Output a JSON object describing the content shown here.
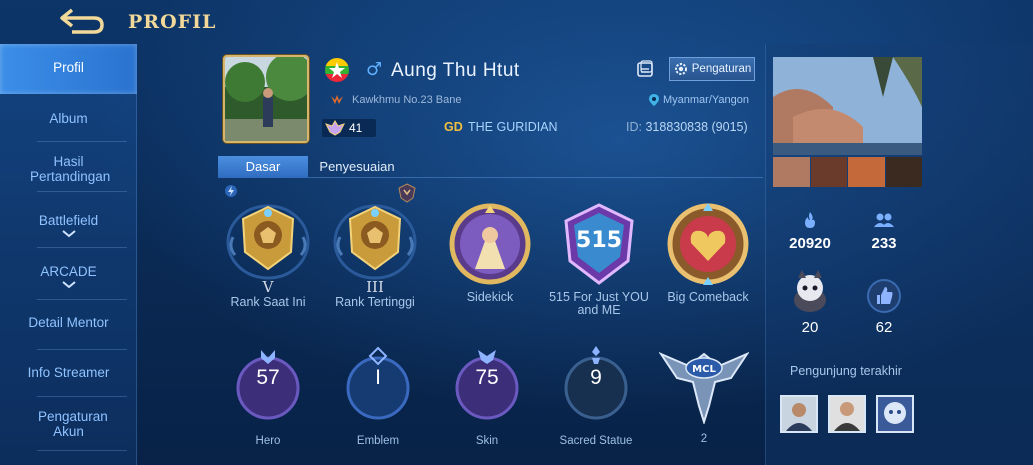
{
  "header": {
    "title": "PROFIL"
  },
  "sidebar": {
    "items": [
      {
        "label": "Profil"
      },
      {
        "label": "Album"
      },
      {
        "label": "Hasil Pertandingan"
      },
      {
        "label": "Battlefield"
      },
      {
        "label": "ARCADE"
      },
      {
        "label": "Detail Mentor"
      },
      {
        "label": "Info Streamer"
      },
      {
        "label": "Pengaturan Akun"
      }
    ]
  },
  "profile": {
    "name": "Aung Thu Htut",
    "gender_symbol": "♂",
    "squad": "Kawkhmu No.23 Bane",
    "level": "41",
    "guild_tag": "GD",
    "guild_name": "THE GURIDIAN",
    "location": "Myanmar/Yangon",
    "id_label": "ID:",
    "id_value": "318830838 (9015)",
    "settings_label": "Pengaturan"
  },
  "tabs": [
    {
      "label": "Dasar"
    },
    {
      "label": "Penyesuaian"
    }
  ],
  "badges": [
    {
      "roman": "V",
      "label": "Rank Saat Ini"
    },
    {
      "roman": "III",
      "label": "Rank Tertinggi"
    },
    {
      "label": "Sidekick"
    },
    {
      "label": "515 For Just YOU and ME",
      "emblem_text": "515"
    },
    {
      "label": "Big Comeback"
    }
  ],
  "stats": [
    {
      "value": "57",
      "label": "Hero"
    },
    {
      "value": "I",
      "label": "Emblem"
    },
    {
      "value": "75",
      "label": "Skin"
    },
    {
      "value": "9",
      "label": "Sacred Statue"
    },
    {
      "value": "2",
      "label": "",
      "emblem_text": "MCL"
    }
  ],
  "right": {
    "popularity": "20920",
    "friends": "233",
    "likes_received": "20",
    "likes_given": "62",
    "visitors_title": "Pengunjung terakhir"
  },
  "colors": {
    "accent": "#3b8ee8",
    "gold": "#d7b56d",
    "background": "#0b2a52"
  }
}
